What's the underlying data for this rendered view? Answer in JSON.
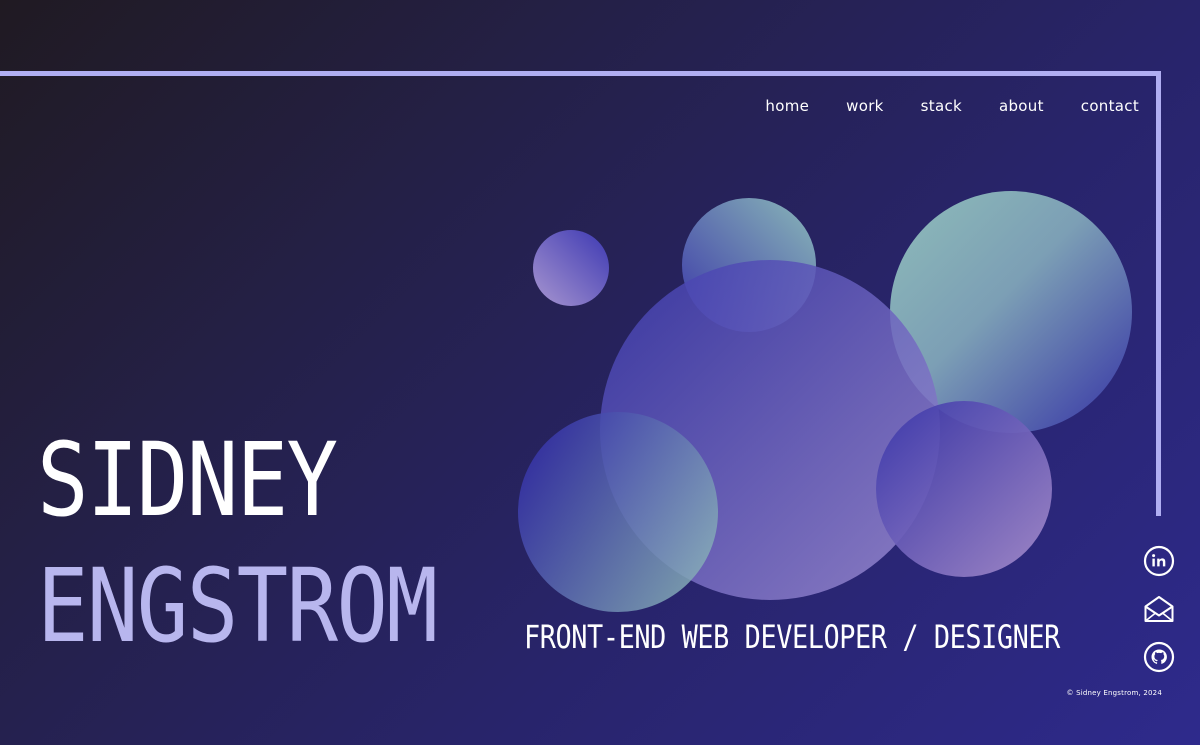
{
  "nav": {
    "items": [
      {
        "label": "home"
      },
      {
        "label": "work"
      },
      {
        "label": "stack"
      },
      {
        "label": "about"
      },
      {
        "label": "contact"
      }
    ]
  },
  "hero": {
    "first_name": "SIDNEY",
    "last_name": "ENGSTROM",
    "role": "FRONT-END WEB DEVELOPER / DESIGNER"
  },
  "social": {
    "linkedin_icon": "linkedin-icon",
    "email_icon": "envelope-icon",
    "github_icon": "github-icon"
  },
  "footer": {
    "copyright": "© Sidney Engstrom, 2024"
  },
  "colors": {
    "frame": "#b0aef2",
    "name_first": "#ffffff",
    "name_last": "#b8b6ee",
    "bubble_teal": "#8fb3b7",
    "bubble_indigo": "#3a36a4",
    "bubble_lavender": "#a08bcc"
  }
}
